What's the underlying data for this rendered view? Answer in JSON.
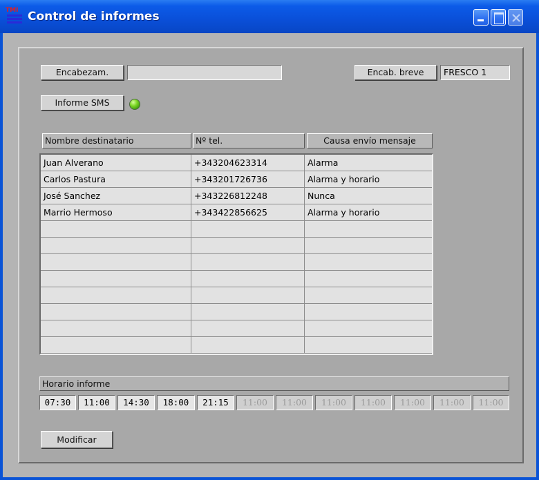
{
  "window": {
    "title": "Control de informes",
    "icon_text": "TMI"
  },
  "header": {
    "encabezam_button": "Encabezam.",
    "encabezam_value": "",
    "encab_breve_button": "Encab. breve",
    "encab_breve_value": "FRESCO 1",
    "informe_sms_button": "Informe SMS",
    "informe_sms_led_color": "#7bd624"
  },
  "table": {
    "columns": [
      "Nombre destinatario",
      "Nº tel.",
      "Causa envío mensaje"
    ],
    "rows": [
      [
        "Juan Alverano",
        "+343204623314",
        "Alarma"
      ],
      [
        "Carlos Pastura",
        "+343201726736",
        "Alarma y horario"
      ],
      [
        "José Sanchez",
        "+343226812248",
        "Nunca"
      ],
      [
        "Marrio Hermoso",
        "+343422856625",
        "Alarma y horario"
      ],
      [
        "",
        "",
        ""
      ],
      [
        "",
        "",
        ""
      ],
      [
        "",
        "",
        ""
      ],
      [
        "",
        "",
        ""
      ],
      [
        "",
        "",
        ""
      ],
      [
        "",
        "",
        ""
      ],
      [
        "",
        "",
        ""
      ],
      [
        "",
        "",
        ""
      ]
    ]
  },
  "schedule": {
    "label": "Horario informe",
    "times": [
      {
        "value": "07:30",
        "enabled": true
      },
      {
        "value": "11:00",
        "enabled": true
      },
      {
        "value": "14:30",
        "enabled": true
      },
      {
        "value": "18:00",
        "enabled": true
      },
      {
        "value": "21:15",
        "enabled": true
      },
      {
        "value": "11:00",
        "enabled": false
      },
      {
        "value": "11:00",
        "enabled": false
      },
      {
        "value": "11:00",
        "enabled": false
      },
      {
        "value": "11:00",
        "enabled": false
      },
      {
        "value": "11:00",
        "enabled": false
      },
      {
        "value": "11:00",
        "enabled": false
      },
      {
        "value": "11:00",
        "enabled": false
      }
    ]
  },
  "actions": {
    "modificar_button": "Modificar"
  }
}
